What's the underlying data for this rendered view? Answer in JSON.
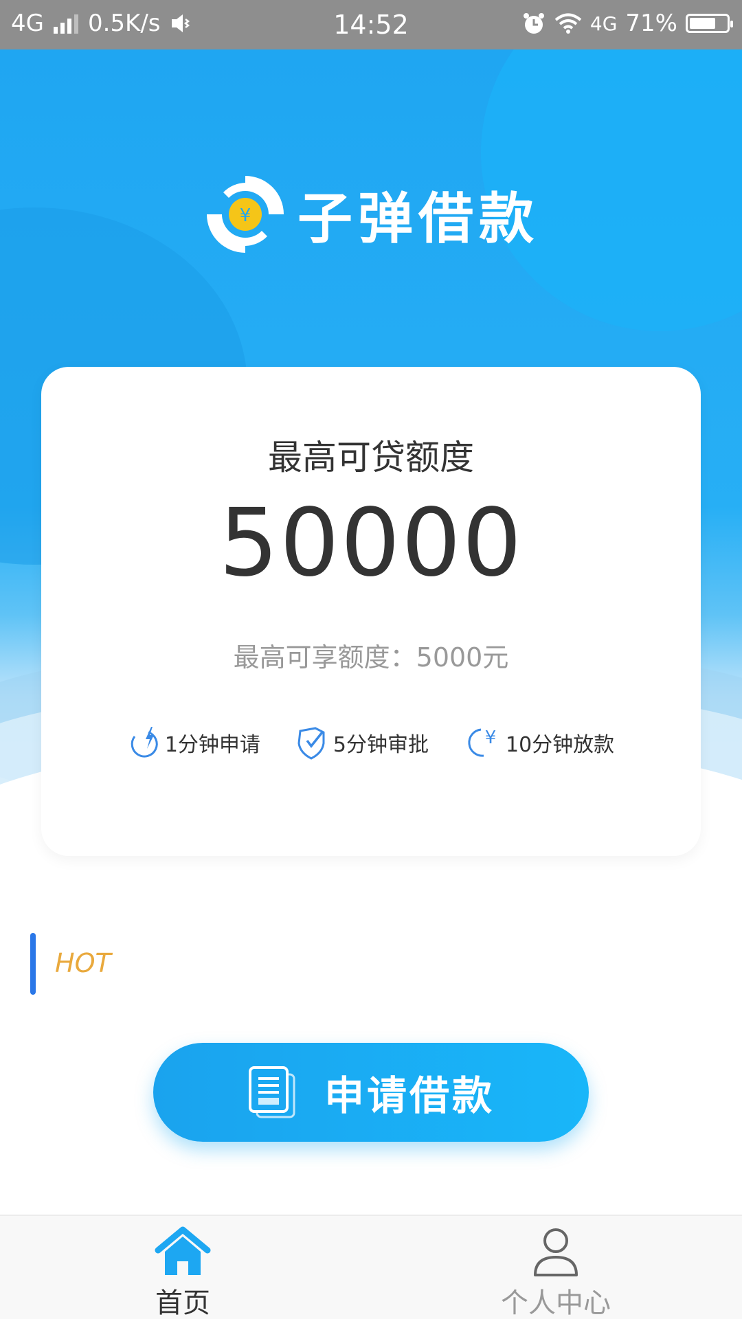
{
  "status_bar": {
    "network": "4G",
    "speed": "0.5K/s",
    "time": "14:52",
    "network_right": "4G",
    "battery": "71%",
    "battery_level": 0.71
  },
  "app": {
    "title": "子弹借款",
    "logo_symbol": "¥"
  },
  "card": {
    "label": "最高可贷额度",
    "amount": "50000",
    "sub_text": "最高可享额度：5000元",
    "features": [
      {
        "icon": "lightning-clock-icon",
        "label": "1分钟申请"
      },
      {
        "icon": "shield-check-icon",
        "label": "5分钟审批"
      },
      {
        "icon": "yuan-clock-icon",
        "label": "10分钟放款"
      }
    ]
  },
  "hot": {
    "label": "HOT"
  },
  "apply_button": {
    "label": "申请借款",
    "icon": "document-icon"
  },
  "bottom_nav": {
    "items": [
      {
        "label": "首页",
        "icon": "home-icon",
        "active": true
      },
      {
        "label": "个人中心",
        "icon": "person-icon",
        "active": false
      }
    ]
  },
  "colors": {
    "primary": "#1fa6f2",
    "hot": "#e9a93d",
    "accent_bar": "#2a77e8",
    "logo_coin": "#f5c518"
  }
}
